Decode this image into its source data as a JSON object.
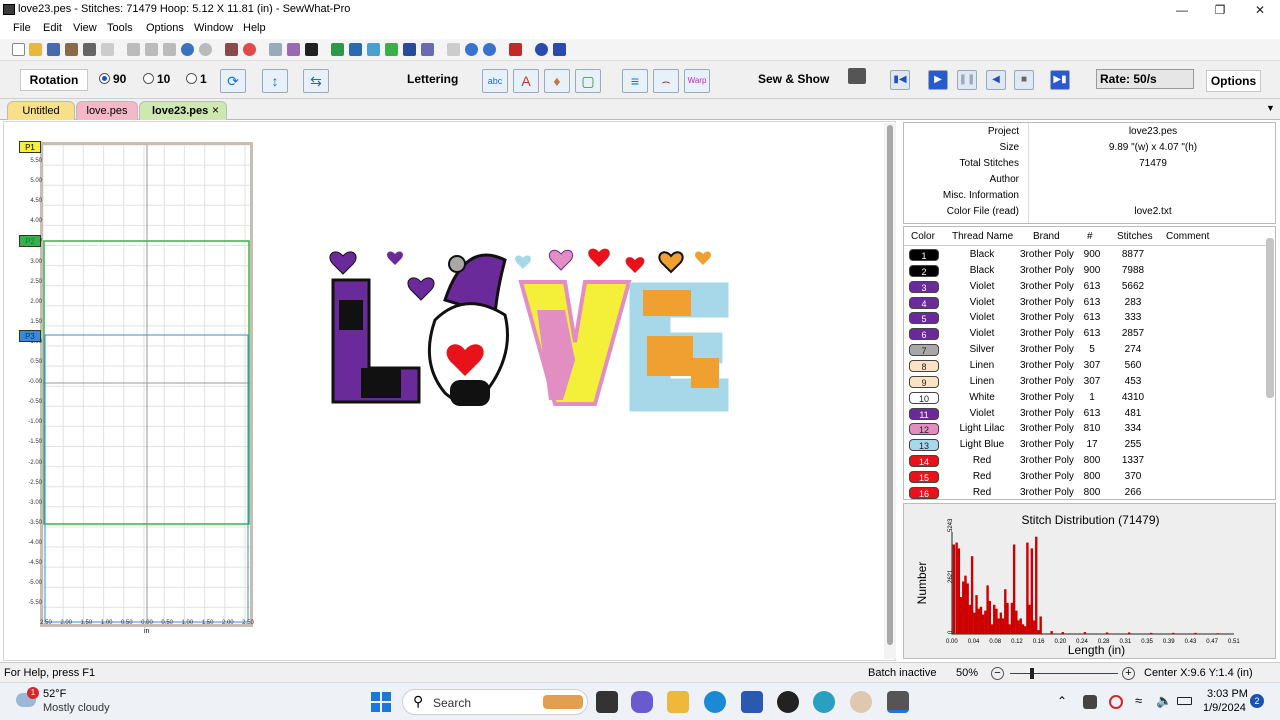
{
  "window": {
    "title": "love23.pes - Stitches: 71479  Hoop: 5.12 X 11.81 (in) - SewWhat-Pro"
  },
  "menu": [
    "File",
    "Edit",
    "View",
    "Tools",
    "Options",
    "Window",
    "Help"
  ],
  "toolbar2": {
    "rotation_label": "Rotation",
    "rotation_options": [
      "90",
      "10",
      "1"
    ],
    "rotation_selected": "90",
    "lettering_label": "Lettering",
    "sew_show_label": "Sew & Show",
    "rate_label": "Rate:   50/s",
    "options_label": "Options"
  },
  "tabs": [
    {
      "label": "Untitled",
      "color": "#f8e08a"
    },
    {
      "label": "love.pes",
      "color": "#f5b8c8"
    },
    {
      "label": "love23.pes",
      "color": "#cfe8b0",
      "active": true
    }
  ],
  "tab_close": "×",
  "hoop": {
    "markers": [
      "P1",
      "P2",
      "P3"
    ],
    "y_ticks": [
      "5.50",
      "5.00",
      "4.50",
      "4.00",
      "3.50",
      "3.00",
      "2.50",
      "2.00",
      "1.50",
      "1.00",
      "0.50",
      "-0.00",
      "-0.50",
      "-1.00",
      "-1.50",
      "-2.00",
      "-2.50",
      "-3.00",
      "-3.50",
      "-4.00",
      "-4.50",
      "-5.00",
      "-5.50"
    ],
    "x_ticks": [
      "2.50",
      "2.00",
      "1.50",
      "1.00",
      "0.50",
      "0.00",
      "0.50",
      "1.00",
      "1.50",
      "2.00",
      "2.50"
    ],
    "x_unit": "in"
  },
  "design": {
    "letters": [
      "L",
      "V",
      "E"
    ]
  },
  "properties": [
    {
      "key": "Project",
      "value": "love23.pes"
    },
    {
      "key": "Size",
      "value": "9.89 \"(w) x 4.07 \"(h)"
    },
    {
      "key": "Total Stitches",
      "value": "71479"
    },
    {
      "key": "Author",
      "value": ""
    },
    {
      "key": "Misc. Information",
      "value": ""
    },
    {
      "key": "Color File (read)",
      "value": "love2.txt"
    }
  ],
  "thread_headers": [
    "Color",
    "Thread Name",
    "Brand",
    "#",
    "Stitches",
    "Comment"
  ],
  "threads": [
    {
      "n": "1",
      "name": "Black",
      "brand": "3rother Poly",
      "num": "900",
      "stitches": "8877",
      "color": "#000000"
    },
    {
      "n": "2",
      "name": "Black",
      "brand": "3rother Poly",
      "num": "900",
      "stitches": "7988",
      "color": "#000000"
    },
    {
      "n": "3",
      "name": "Violet",
      "brand": "3rother Poly",
      "num": "613",
      "stitches": "5662",
      "color": "#6a2a9a"
    },
    {
      "n": "4",
      "name": "Violet",
      "brand": "3rother Poly",
      "num": "613",
      "stitches": "283",
      "color": "#6a2a9a"
    },
    {
      "n": "5",
      "name": "Violet",
      "brand": "3rother Poly",
      "num": "613",
      "stitches": "333",
      "color": "#6a2a9a"
    },
    {
      "n": "6",
      "name": "Violet",
      "brand": "3rother Poly",
      "num": "613",
      "stitches": "2857",
      "color": "#6a2a9a"
    },
    {
      "n": "7",
      "name": "Silver",
      "brand": "3rother Poly",
      "num": "5",
      "stitches": "274",
      "color": "#a8a8a8"
    },
    {
      "n": "8",
      "name": "Linen",
      "brand": "3rother Poly",
      "num": "307",
      "stitches": "560",
      "color": "#fbe3c6"
    },
    {
      "n": "9",
      "name": "Linen",
      "brand": "3rother Poly",
      "num": "307",
      "stitches": "453",
      "color": "#fbe3c6"
    },
    {
      "n": "10",
      "name": "White",
      "brand": "3rother Poly",
      "num": "1",
      "stitches": "4310",
      "color": "#ffffff"
    },
    {
      "n": "11",
      "name": "Violet",
      "brand": "3rother Poly",
      "num": "613",
      "stitches": "481",
      "color": "#6a2a9a"
    },
    {
      "n": "12",
      "name": "Light Lilac",
      "brand": "3rother Poly",
      "num": "810",
      "stitches": "334",
      "color": "#e38ec2"
    },
    {
      "n": "13",
      "name": "Light Blue",
      "brand": "3rother Poly",
      "num": "17",
      "stitches": "255",
      "color": "#a7d8ea"
    },
    {
      "n": "14",
      "name": "Red",
      "brand": "3rother Poly",
      "num": "800",
      "stitches": "1337",
      "color": "#e8121a"
    },
    {
      "n": "15",
      "name": "Red",
      "brand": "3rother Poly",
      "num": "800",
      "stitches": "370",
      "color": "#e8121a"
    },
    {
      "n": "16",
      "name": "Red",
      "brand": "3rother Poly",
      "num": "800",
      "stitches": "266",
      "color": "#e8121a"
    }
  ],
  "histogram": {
    "title": "Stitch Distribution (71479)",
    "ylabel": "Number",
    "xlabel": "Length (in)",
    "y_ticks": [
      "5243",
      "2621",
      "0"
    ],
    "x_ticks": [
      "0.00",
      "0.04",
      "0.08",
      "0.12",
      "0.16",
      "0.20",
      "0.24",
      "0.28",
      "0.31",
      "0.35",
      "0.39",
      "0.43",
      "0.47",
      "0.51"
    ]
  },
  "chart_data": {
    "type": "bar",
    "title": "Stitch Distribution (71479)",
    "xlabel": "Length (in)",
    "ylabel": "Number",
    "ylim": [
      0,
      5243
    ],
    "xlim": [
      0,
      0.51
    ],
    "x": [
      0.003,
      0.008,
      0.012,
      0.016,
      0.02,
      0.024,
      0.028,
      0.032,
      0.036,
      0.04,
      0.044,
      0.048,
      0.052,
      0.056,
      0.06,
      0.064,
      0.068,
      0.072,
      0.076,
      0.08,
      0.084,
      0.088,
      0.092,
      0.096,
      0.1,
      0.104,
      0.108,
      0.112,
      0.116,
      0.12,
      0.124,
      0.128,
      0.132,
      0.136,
      0.14,
      0.144,
      0.148,
      0.152,
      0.156,
      0.16,
      0.18,
      0.2,
      0.24,
      0.28,
      0.32,
      0.36,
      0.4,
      0.44,
      0.48
    ],
    "values": [
      4600,
      4700,
      4400,
      1900,
      2700,
      3000,
      2600,
      1500,
      4000,
      1100,
      2000,
      1300,
      1400,
      1000,
      1200,
      2500,
      1700,
      500,
      1500,
      1300,
      800,
      1100,
      800,
      2300,
      1600,
      500,
      1600,
      4600,
      1200,
      700,
      800,
      500,
      400,
      4700,
      1500,
      4400,
      700,
      5000,
      200,
      900,
      150,
      100,
      100,
      80,
      80,
      60,
      60,
      60,
      40
    ]
  },
  "statusbar": {
    "help": "For Help, press F1",
    "batch": "Batch inactive",
    "zoom": "50%",
    "center": "Center X:9.6  Y:1.4 (in)"
  },
  "taskbar": {
    "temp": "52°F",
    "weather": "Mostly cloudy",
    "weather_badge": "1",
    "search": "Search",
    "time": "3:03 PM",
    "date": "1/9/2024",
    "notif_count": "2"
  }
}
